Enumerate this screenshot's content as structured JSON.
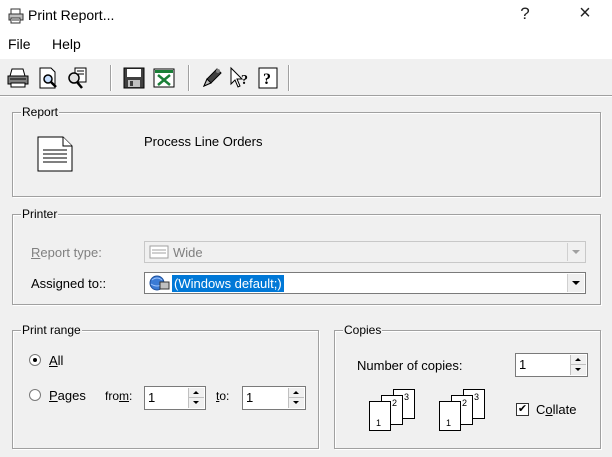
{
  "window": {
    "title": "Print Report...",
    "help_button": "?",
    "close_button": "×"
  },
  "menu": {
    "items": [
      "File",
      "Help"
    ]
  },
  "toolbar": {
    "icons": [
      "print-icon",
      "print-preview-icon",
      "zoom-preview-icon",
      "save-icon",
      "excel-export-icon",
      "pencil-icon",
      "whats-this-icon",
      "help-icon"
    ]
  },
  "report": {
    "group_label": "Report",
    "name": "Process Line Orders"
  },
  "printer": {
    "group_label": "Printer",
    "report_type_label_pre": "",
    "report_type_label_accel": "R",
    "report_type_label_post": "eport type:",
    "report_type_value": "Wide",
    "assigned_label_pre": "Assi",
    "assigned_label_accel": "g",
    "assigned_label_post": "ned to::",
    "assigned_value": "(Windows default;)"
  },
  "print_range": {
    "group_label": "Print range",
    "all_pre": "",
    "all_accel": "A",
    "all_post": "ll",
    "pages_pre": "",
    "pages_accel": "P",
    "pages_post": "ages",
    "from_pre": "fro",
    "from_accel": "m",
    "from_post": ":",
    "from_value": "1",
    "to_pre": "",
    "to_accel": "t",
    "to_post": "o:",
    "to_value": "1",
    "selected": "All"
  },
  "copies": {
    "group_label": "Copies",
    "number_label": "Number of copies:",
    "number_value": "1",
    "collate_pre": "C",
    "collate_accel": "o",
    "collate_post": "llate",
    "collate_checked": true,
    "page_numbers": [
      "1",
      "2",
      "3"
    ]
  }
}
